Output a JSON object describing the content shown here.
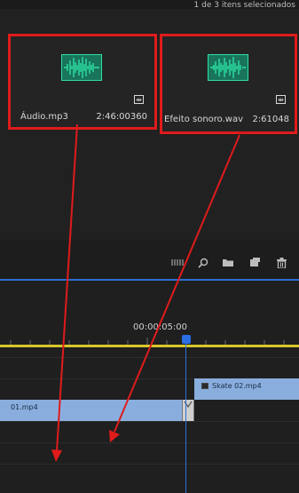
{
  "header": {
    "selection_text": "1 de 3 itens selecionados"
  },
  "project_panel": {
    "clips": [
      {
        "name": "Áudio.mp3",
        "duration": "2:46:00360",
        "icon": "audio-waveform-icon"
      },
      {
        "name": "Efeito sonoro.wav",
        "duration": "2:61048",
        "icon": "audio-waveform-icon"
      }
    ],
    "toolbar_icons": [
      "list-view-icon",
      "search-icon",
      "folder-icon",
      "new-item-icon",
      "trash-icon"
    ]
  },
  "timeline": {
    "timecode": "00:00:05:00",
    "clips": [
      {
        "name": "Skate 02.mp4",
        "track": "V2"
      },
      {
        "name": "01.mp4",
        "track": "V1"
      }
    ]
  },
  "colors": {
    "highlight": "#e01b1b",
    "playhead": "#2b6fe2",
    "ruler": "#d7c72a",
    "clip": "#89aede",
    "waveform": "#2de0a6"
  }
}
